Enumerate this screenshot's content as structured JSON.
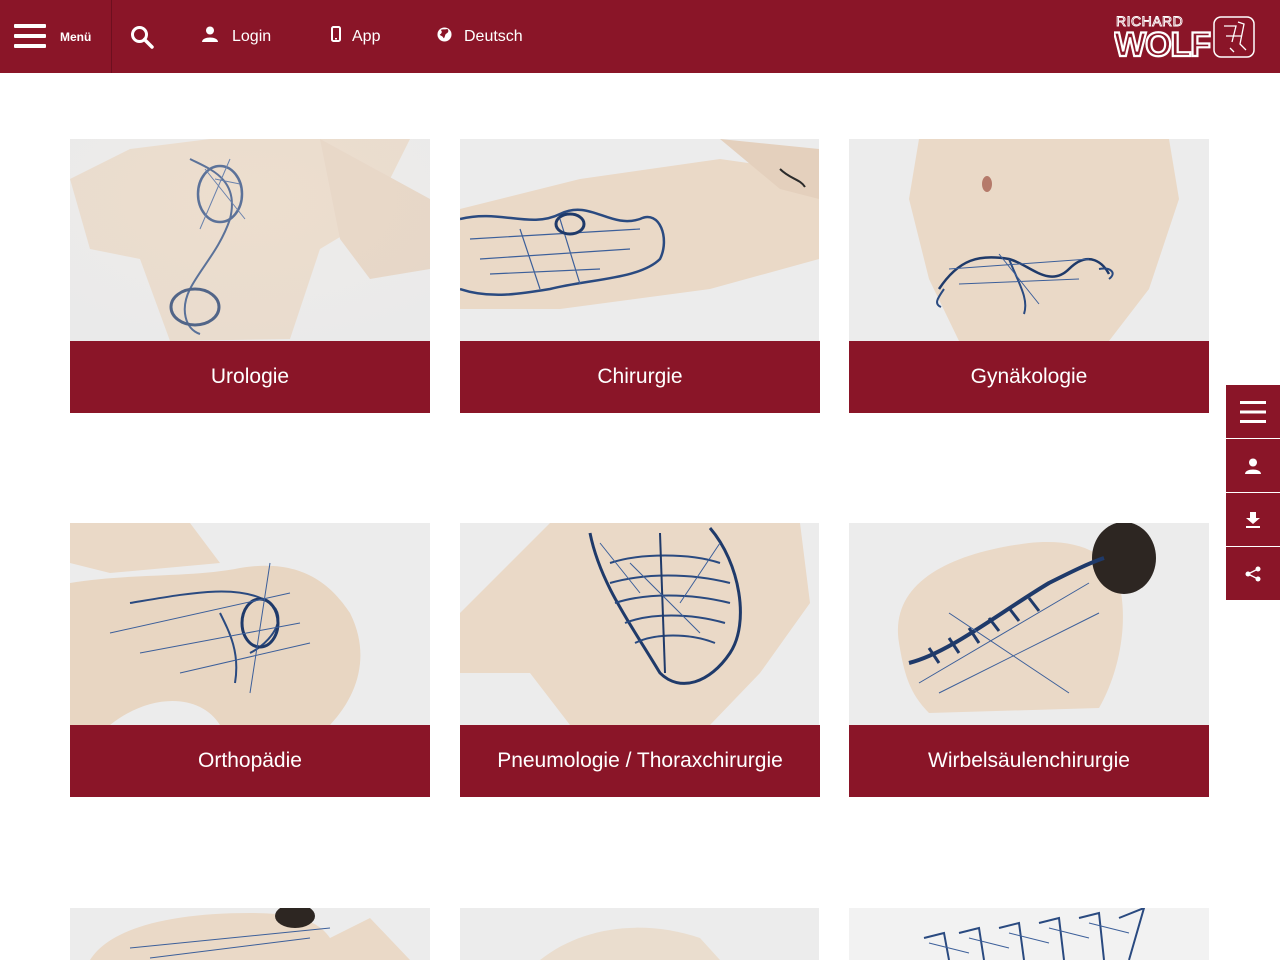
{
  "header": {
    "menu_label": "Menü",
    "nav": [
      {
        "label": "Login",
        "icon": "user-icon"
      },
      {
        "label": "App",
        "icon": "smartphone-icon"
      },
      {
        "label": "Deutsch",
        "icon": "globe-icon"
      }
    ],
    "logo_top": "RICHARD",
    "logo_main": "WOLF"
  },
  "tiles": [
    {
      "label": "Urologie"
    },
    {
      "label": "Chirurgie"
    },
    {
      "label": "Gynäkologie"
    },
    {
      "label": "Orthopädie"
    },
    {
      "label": "Pneumologie / Thoraxchirurgie"
    },
    {
      "label": "Wirbelsäulenchirurgie"
    }
  ],
  "sidebar": [
    {
      "icon": "menu-icon"
    },
    {
      "icon": "user-icon"
    },
    {
      "icon": "download-icon"
    },
    {
      "icon": "share-icon"
    }
  ],
  "colors": {
    "brand": "#8a1528",
    "background": "#ffffff"
  }
}
